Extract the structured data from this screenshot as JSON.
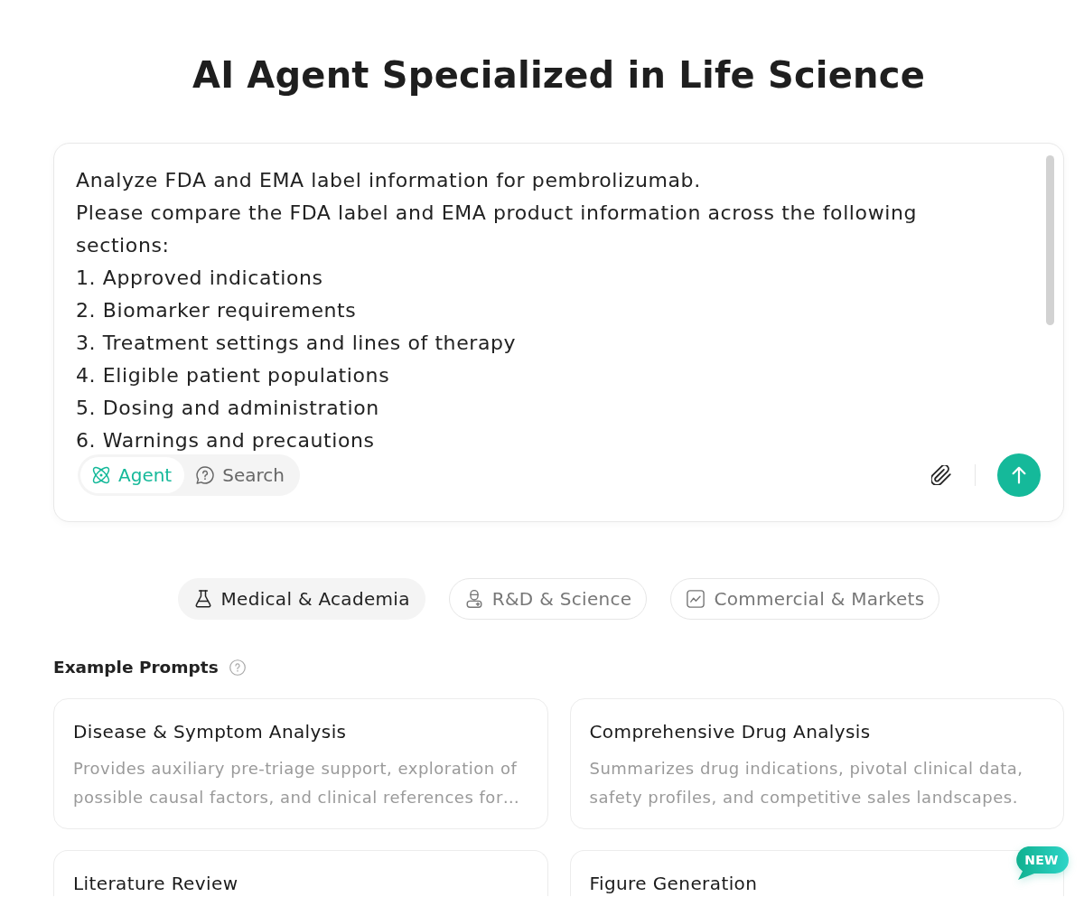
{
  "title": "AI Agent Specialized in Life Science",
  "prompt_box": {
    "value": "Analyze FDA and EMA label information for pembrolizumab.\nPlease compare the FDA label and EMA product information across the following sections:\n1. Approved indications\n2. Biomarker requirements\n3. Treatment settings and lines of therapy\n4. Eligible patient populations\n5. Dosing and administration\n6. Warnings and precautions",
    "modes": [
      {
        "label": "Agent",
        "selected": true
      },
      {
        "label": "Search",
        "selected": false
      }
    ]
  },
  "categories": [
    {
      "label": "Medical & Academia",
      "selected": true
    },
    {
      "label": "R&D & Science",
      "selected": false
    },
    {
      "label": "Commercial & Markets",
      "selected": false
    }
  ],
  "example_prompts": {
    "heading": "Example Prompts",
    "cards": [
      {
        "title": "Disease & Symptom Analysis",
        "description": "Provides auxiliary pre-triage support, exploration of possible causal factors, and clinical references for…"
      },
      {
        "title": "Comprehensive Drug Analysis",
        "description": "Summarizes drug indications, pivotal clinical data, safety profiles, and competitive sales landscapes."
      },
      {
        "title": "Literature Review"
      },
      {
        "title": "Figure Generation"
      }
    ],
    "badge": "NEW"
  }
}
